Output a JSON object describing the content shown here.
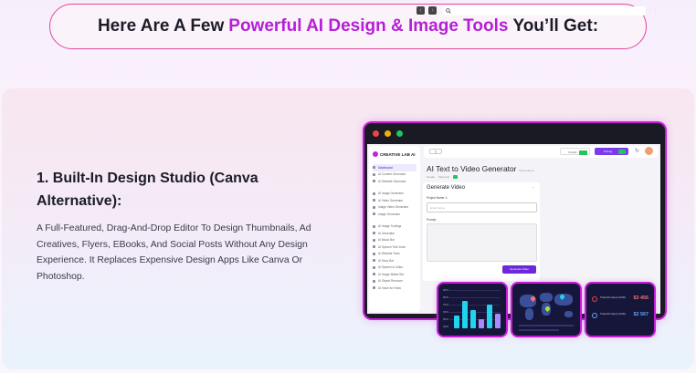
{
  "headline": {
    "prefix": "Here Are A Few",
    "accent": "Powerful AI Design & Image Tools",
    "suffix": "You’ll Get:",
    "accent_color": "#b51fd6"
  },
  "feature": {
    "title": "1. Built-In Design Studio (Canva Alternative):",
    "description": "A Full-Featured, Drag-And-Drop Editor To Design Thumbnails, Ad Creatives, Flyers, EBooks, And Social Posts Without Any Design Experience. It Replaces Expensive Design Apps Like Canva Or Photoshop."
  },
  "mockup": {
    "brand": "CREATIVE LAB AI",
    "sidebar_items": [
      "Dashboard",
      "AI Content Generator",
      "AI Website Generator",
      "AI Image Generator",
      "AI Video Generator",
      "Image Video Generator",
      "Image Generator",
      "AI Image Toolings",
      "AI Generator",
      "AI Music Bot",
      "AI Speech Text Voice",
      "AI Website Tools",
      "AI Story Bot",
      "AI Speech to Video",
      "AI Image Maker Bot",
      "AI Object Remover",
      "AI Voice for Video"
    ],
    "menu_label": "≡",
    "credits_label": "Credits",
    "pricing_label": "Pricing",
    "page_title": "AI Text to Video Generator",
    "page_title_note": "New feature",
    "tabs": [
      "Create",
      "View List"
    ],
    "panel_title": "Generate Video",
    "project_label": "Project Name ①",
    "project_placeholder": "Enter Name",
    "prompt_label": "Prompt",
    "generate_button": "Generate Video",
    "chart_ticks": [
      "90%",
      "80%",
      "70%",
      "60%",
      "50%",
      "40%"
    ],
    "stats": [
      {
        "label": "Total Ads Spent (USD)",
        "value": "$3 456",
        "color": "#f87171"
      },
      {
        "label": "Total Ads Spent (USD)",
        "value": "$2 567",
        "color": "#60a5fa"
      }
    ]
  },
  "colors": {
    "pink_border": "#e0489d",
    "mockup_glow": "#c61ed9",
    "primary": "#7c3aed"
  }
}
